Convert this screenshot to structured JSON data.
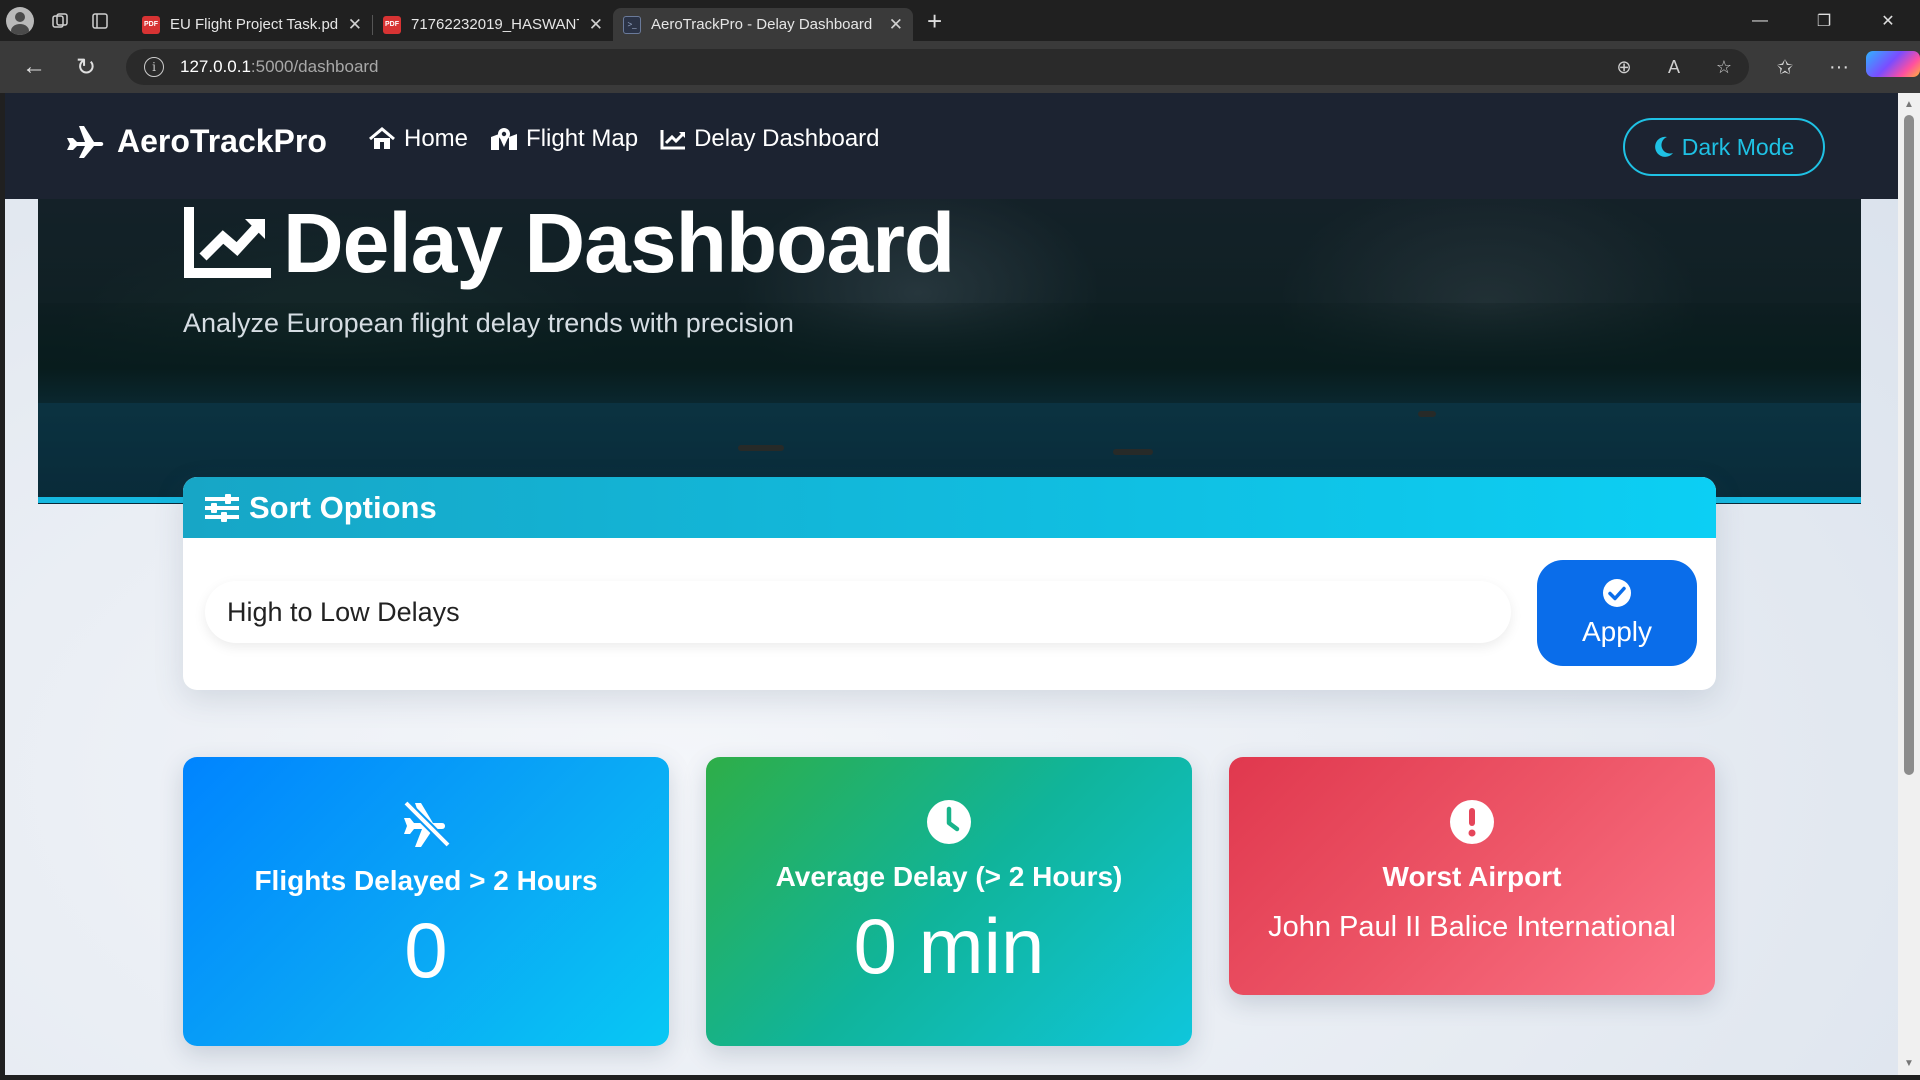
{
  "browser": {
    "tabs": [
      {
        "title": "EU Flight Project Task.pdf",
        "favicon": "pdf-icon"
      },
      {
        "title": "71762232019_HASWANTH_R_RES",
        "favicon": "pdf-icon"
      },
      {
        "title": "AeroTrackPro - Delay Dashboard",
        "favicon": "app-icon",
        "active": true
      }
    ],
    "url_host": "127.0.0.1",
    "url_path": ":5000/dashboard"
  },
  "navbar": {
    "brand": "AeroTrackPro",
    "links": [
      "Home",
      "Flight Map",
      "Delay Dashboard"
    ],
    "dark_mode_label": "Dark Mode"
  },
  "hero": {
    "title": "Delay Dashboard",
    "subtitle": "Analyze European flight delay trends with precision"
  },
  "sort": {
    "header": "Sort Options",
    "selected": "High to Low Delays",
    "apply_label": "Apply"
  },
  "stats": [
    {
      "title": "Flights Delayed > 2 Hours",
      "value": "0",
      "icon": "plane-slash-icon"
    },
    {
      "title": "Average Delay (> 2 Hours)",
      "value": "0 min",
      "icon": "clock-icon"
    },
    {
      "title": "Worst Airport",
      "value": "John Paul II Balice International",
      "icon": "exclamation-circle-icon"
    }
  ],
  "colors": {
    "accent": "#1fc1e4",
    "navbar_bg": "#1c2331",
    "apply_button": "#0a6dea"
  }
}
